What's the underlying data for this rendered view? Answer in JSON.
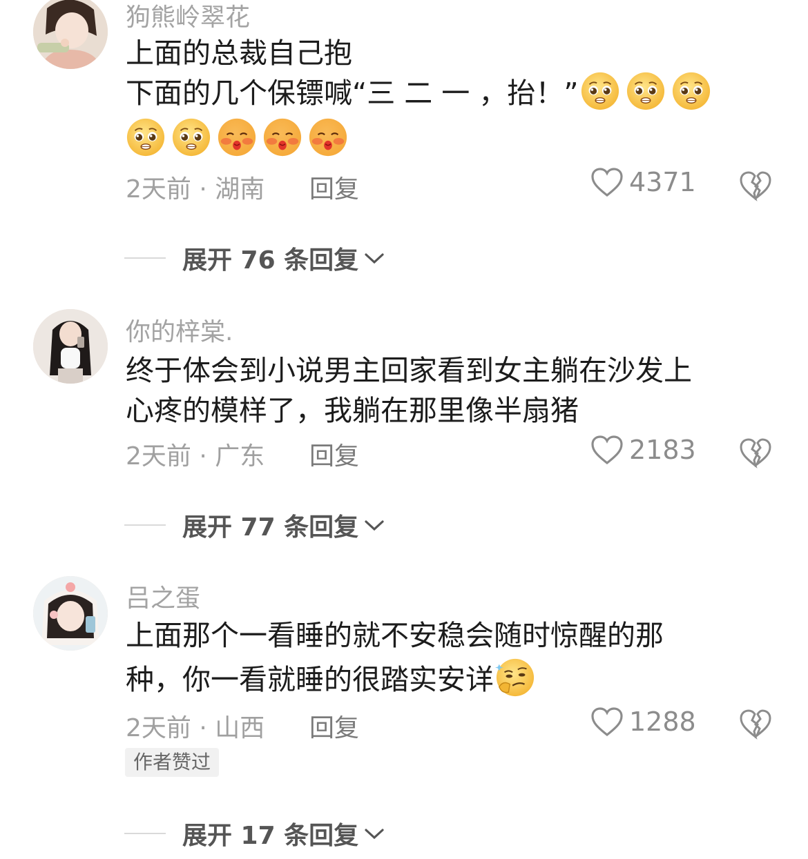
{
  "comments": [
    {
      "username": "狗熊岭翠花",
      "line1": "上面的总裁自己抱",
      "line2": "下面的几个保镖喊“三 二 一 ，抬！”",
      "emoji_inline": [
        "pleading-face",
        "pleading-face",
        "pleading-face"
      ],
      "emoji_row": [
        "pleading-face",
        "pleading-face",
        "blush-kiss-face",
        "blush-kiss-face",
        "blush-kiss-face"
      ],
      "meta": "2天前 · 湖南",
      "reply": "回复",
      "likes": "4371",
      "expand": "展开 76 条回复"
    },
    {
      "username": "你的梓棠.",
      "line1": "终于体会到小说男主回家看到女主躺在沙发上",
      "line2": "心疼的模样了，我躺在那里像半扇猪",
      "meta": "2天前 · 广东",
      "reply": "回复",
      "likes": "2183",
      "expand": "展开 77 条回复"
    },
    {
      "username": "吕之蛋",
      "line1": "上面那个一看睡的就不安稳会随时惊醒的那",
      "line2": "种，你一看就睡的很踏实安详",
      "emoji_inline": [
        "thinking-smirk-face"
      ],
      "meta": "2天前 · 山西",
      "reply": "回复",
      "likes": "1288",
      "badge": "作者赞过",
      "expand": "展开 17 条回复"
    }
  ],
  "icons": {
    "like": "heart-outline-icon",
    "dislike": "broken-heart-icon",
    "expand": "chevron-down-icon"
  },
  "colors": {
    "username": "#a3a3a3",
    "text": "#1c1c1c",
    "meta": "#a0a0a0",
    "emoji_yellow": "#f7c948"
  }
}
